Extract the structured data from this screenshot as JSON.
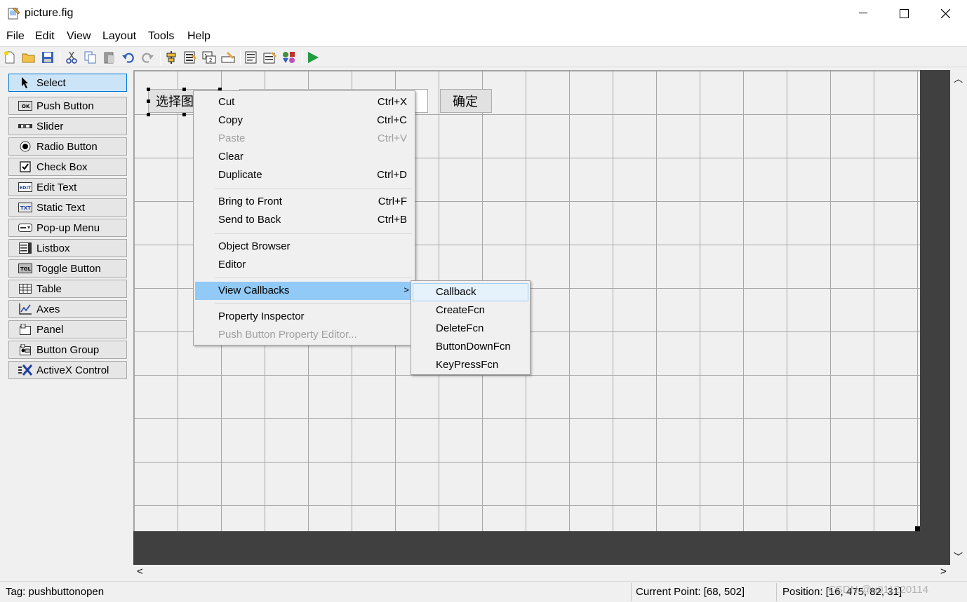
{
  "window": {
    "title": "picture.fig",
    "minimize": "—",
    "maximize": "☐",
    "close": "✕"
  },
  "menubar": [
    "File",
    "Edit",
    "View",
    "Layout",
    "Tools",
    "Help"
  ],
  "palette": [
    {
      "label": "Select",
      "icon": "arrow-cursor-icon"
    },
    {
      "label": "Push Button",
      "icon": "push-button-icon"
    },
    {
      "label": "Slider",
      "icon": "slider-icon"
    },
    {
      "label": "Radio Button",
      "icon": "radio-button-icon"
    },
    {
      "label": "Check Box",
      "icon": "check-box-icon"
    },
    {
      "label": "Edit Text",
      "icon": "edit-text-icon"
    },
    {
      "label": "Static Text",
      "icon": "static-text-icon"
    },
    {
      "label": "Pop-up Menu",
      "icon": "popup-menu-icon"
    },
    {
      "label": "Listbox",
      "icon": "listbox-icon"
    },
    {
      "label": "Toggle Button",
      "icon": "toggle-button-icon"
    },
    {
      "label": "Table",
      "icon": "table-icon"
    },
    {
      "label": "Axes",
      "icon": "axes-icon"
    },
    {
      "label": "Panel",
      "icon": "panel-icon"
    },
    {
      "label": "Button Group",
      "icon": "button-group-icon"
    },
    {
      "label": "ActiveX Control",
      "icon": "activex-icon"
    }
  ],
  "palette_icon_text": {
    "ok": "OK",
    "edit": "EDIT",
    "txt": "TXT",
    "tgl": "TGL"
  },
  "canvas": {
    "button1_label": "选择图",
    "button2_label": "确定"
  },
  "context_menu": {
    "cut": {
      "label": "Cut",
      "shortcut": "Ctrl+X"
    },
    "copy": {
      "label": "Copy",
      "shortcut": "Ctrl+C"
    },
    "paste": {
      "label": "Paste",
      "shortcut": "Ctrl+V"
    },
    "clear": {
      "label": "Clear"
    },
    "duplicate": {
      "label": "Duplicate",
      "shortcut": "Ctrl+D"
    },
    "bring_to_front": {
      "label": "Bring to Front",
      "shortcut": "Ctrl+F"
    },
    "send_to_back": {
      "label": "Send to Back",
      "shortcut": "Ctrl+B"
    },
    "object_browser": {
      "label": "Object Browser"
    },
    "editor": {
      "label": "Editor"
    },
    "view_callbacks": {
      "label": "View Callbacks",
      "arrow": ">"
    },
    "property_inspector": {
      "label": "Property Inspector"
    },
    "push_button_editor": {
      "label": "Push Button Property Editor..."
    }
  },
  "submenu": [
    "Callback",
    "CreateFcn",
    "DeleteFcn",
    "ButtonDownFcn",
    "KeyPressFcn"
  ],
  "status": {
    "tag": "Tag: pushbuttonopen",
    "current_point": "Current Point:  [68, 502]",
    "position": "Position: [16, 475, 82, 31]"
  },
  "watermark": "CSDN @u011220114",
  "scroll": {
    "up": "︿",
    "down": "﹀",
    "left": "<",
    "right": ">"
  }
}
